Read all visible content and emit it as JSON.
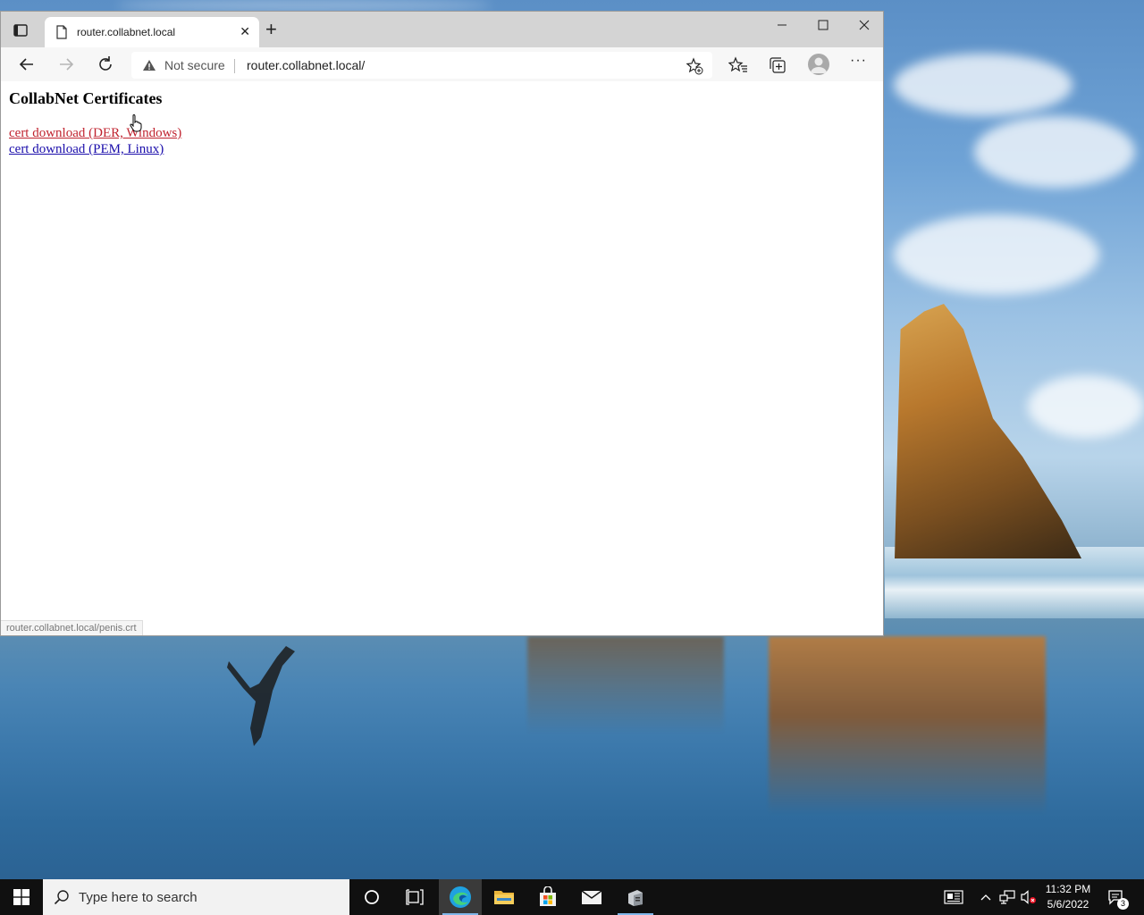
{
  "browser": {
    "tab": {
      "title": "router.collabnet.local"
    },
    "address": {
      "security_label": "Not secure",
      "url": "router.collabnet.local/"
    },
    "status_url": "router.collabnet.local/penis.crt"
  },
  "page": {
    "heading": "CollabNet Certificates",
    "links": [
      {
        "label": "cert download (DER, Windows)",
        "state": "active"
      },
      {
        "label": "cert download (PEM, Linux)",
        "state": "normal"
      }
    ]
  },
  "taskbar": {
    "search_placeholder": "Type here to search",
    "time": "11:32 PM",
    "date": "5/6/2022",
    "notification_count": "3",
    "accent": "#7fb7ea"
  },
  "icons": [
    "tabs-icon",
    "document-icon",
    "close-icon",
    "plus-icon",
    "minimize-icon",
    "maximize-icon",
    "back-icon",
    "forward-icon",
    "refresh-icon",
    "warning-icon",
    "add-favorite-icon",
    "favorites-icon",
    "collections-icon",
    "profile-icon",
    "more-icon",
    "windows-start-icon",
    "search-icon",
    "cortana-icon",
    "task-view-icon",
    "edge-icon",
    "file-explorer-icon",
    "store-icon",
    "mail-icon",
    "server-manager-icon",
    "news-icon",
    "chevron-up-icon",
    "network-icon",
    "volume-muted-icon",
    "notification-icon"
  ]
}
